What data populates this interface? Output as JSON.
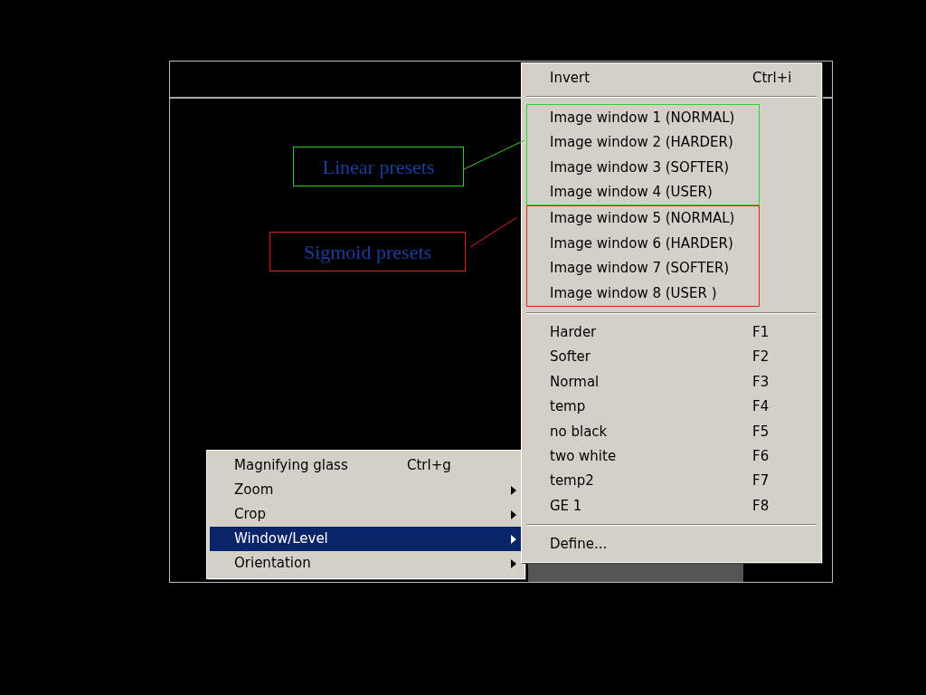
{
  "context_menu": {
    "items": [
      {
        "label": "Magnifying glass",
        "shortcut": "Ctrl+g",
        "submenu": false,
        "selected": false
      },
      {
        "label": "Zoom",
        "submenu": true,
        "selected": false
      },
      {
        "label": "Crop",
        "submenu": true,
        "selected": false
      },
      {
        "label": "Window/Level",
        "submenu": true,
        "selected": true
      },
      {
        "label": "Orientation",
        "submenu": true,
        "selected": false
      }
    ]
  },
  "submenu": {
    "sections": [
      {
        "items": [
          {
            "label": "Invert",
            "shortcut": "Ctrl+i"
          }
        ]
      },
      {
        "groups": [
          {
            "callout": "Linear presets",
            "color": "#33cc33",
            "items": [
              {
                "label": "Image window 1 (NORMAL)"
              },
              {
                "label": "Image window 2 (HARDER)"
              },
              {
                "label": "Image window 3 (SOFTER)"
              },
              {
                "label": "Image window 4 (USER)"
              }
            ]
          },
          {
            "callout": "Sigmoid presets",
            "color": "#dd2222",
            "items": [
              {
                "label": "Image window 5 (NORMAL)"
              },
              {
                "label": "Image window 6 (HARDER)"
              },
              {
                "label": "Image window 7 (SOFTER)"
              },
              {
                "label": "Image window 8 (USER )"
              }
            ]
          }
        ]
      },
      {
        "items": [
          {
            "label": "Harder",
            "shortcut": "F1"
          },
          {
            "label": "Softer",
            "shortcut": "F2"
          },
          {
            "label": "Normal",
            "shortcut": "F3"
          },
          {
            "label": "temp",
            "shortcut": "F4"
          },
          {
            "label": "no black",
            "shortcut": "F5"
          },
          {
            "label": "two white",
            "shortcut": "F6"
          },
          {
            "label": "temp2",
            "shortcut": "F7"
          },
          {
            "label": "GE 1",
            "shortcut": "F8"
          }
        ]
      },
      {
        "items": [
          {
            "label": "Define..."
          }
        ]
      }
    ]
  }
}
